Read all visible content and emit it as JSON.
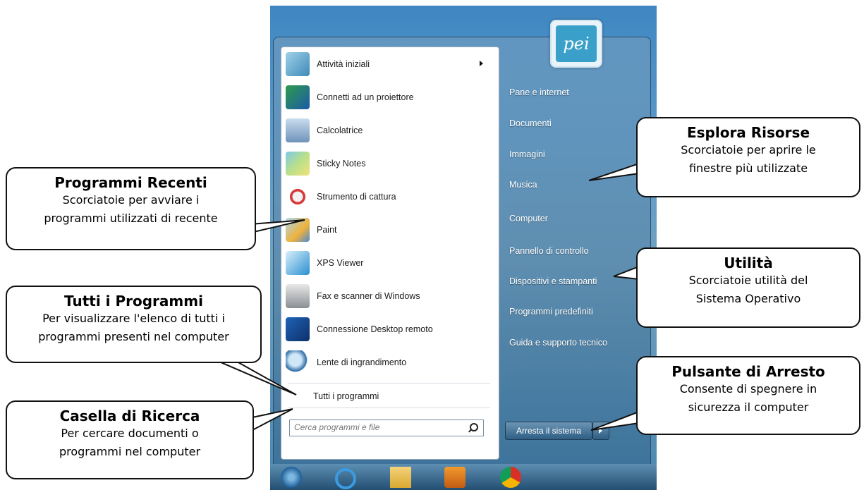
{
  "start_menu": {
    "programs": [
      {
        "label": "Attività iniziali",
        "has_arrow": true,
        "icon": "getting-started-icon"
      },
      {
        "label": "Connetti ad un proiettore",
        "icon": "projector-icon"
      },
      {
        "label": "Calcolatrice",
        "icon": "calculator-icon"
      },
      {
        "label": "Sticky Notes",
        "icon": "sticky-notes-icon"
      },
      {
        "label": "Strumento di cattura",
        "icon": "snipping-tool-icon"
      },
      {
        "label": "Paint",
        "icon": "paint-icon"
      },
      {
        "label": "XPS Viewer",
        "icon": "xps-viewer-icon"
      },
      {
        "label": "Fax e scanner di Windows",
        "icon": "fax-scanner-icon"
      },
      {
        "label": "Connessione Desktop remoto",
        "icon": "remote-desktop-icon"
      },
      {
        "label": "Lente di ingrandimento",
        "icon": "magnifier-icon"
      }
    ],
    "all_programs": "Tutti i programmi",
    "search_placeholder": "Cerca programmi e file",
    "user_pic_text": "pei",
    "right_items": [
      "Pane e internet",
      "Documenti",
      "Immagini",
      "Musica",
      "Computer",
      "Pannello di controllo",
      "Dispositivi e stampanti",
      "Programmi predefiniti",
      "Guida e supporto tecnico"
    ],
    "shutdown_label": "Arresta il sistema"
  },
  "taskbar": {
    "items": [
      "start-orb-icon",
      "internet-explorer-icon",
      "file-explorer-icon",
      "media-player-icon",
      "chrome-icon"
    ]
  },
  "callouts": {
    "recent": {
      "title": "Programmi Recenti",
      "line1": "Scorciatoie per avviare i",
      "line2": "programmi utilizzati di recente"
    },
    "all": {
      "title": "Tutti i Programmi",
      "line1": "Per visualizzare l'elenco di tutti i",
      "line2": "programmi presenti nel computer"
    },
    "search": {
      "title": "Casella di Ricerca",
      "line1": "Per cercare documenti o",
      "line2": "programmi nel computer"
    },
    "explore": {
      "title": "Esplora Risorse",
      "line1": "Scorciatoie per aprire le",
      "line2": "finestre più utilizzate"
    },
    "utility": {
      "title": "Utilità",
      "line1": "Scorciatoie utilità del",
      "line2": "Sistema Operativo"
    },
    "shutdown": {
      "title": "Pulsante di Arresto",
      "line1": "Consente di spegnere in",
      "line2": "sicurezza il computer"
    }
  }
}
